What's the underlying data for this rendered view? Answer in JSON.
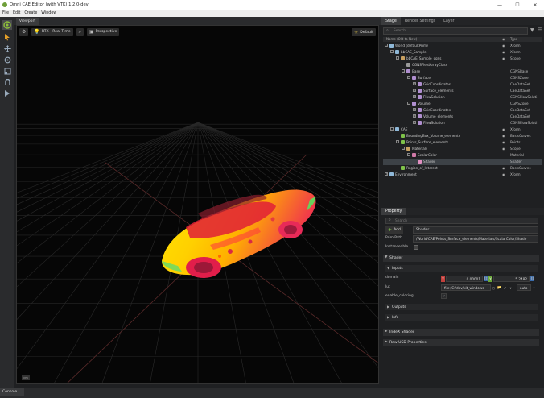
{
  "window": {
    "title": "Omni CAE Editor (with VTK) 1.2.0-dev",
    "minimize": "—",
    "maximize": "☐",
    "close": "✕"
  },
  "menu": [
    "File",
    "Edit",
    "Create",
    "Window"
  ],
  "viewport": {
    "tab": "Viewport",
    "renderer": "RTX - Real-Time",
    "camera": "Perspective",
    "default_label": "Default",
    "corner_label": "cm"
  },
  "console": {
    "tab": "Console"
  },
  "stage": {
    "tabs": [
      "Stage",
      "Render Settings",
      "Layer"
    ],
    "search_placeholder": "Search",
    "header_name": "Name (Old to New)",
    "header_type": "Type",
    "rows": [
      {
        "label": "World (defaultPrim)",
        "type": "Xform",
        "indent": 0,
        "exp": "-",
        "icon": "xform",
        "eye": true
      },
      {
        "label": "bbCAE_Sample",
        "type": "Xform",
        "indent": 1,
        "exp": "-",
        "icon": "xform",
        "eye": true
      },
      {
        "label": "bbCAE_Sample_cgns",
        "type": "Scope",
        "indent": 2,
        "exp": "-",
        "icon": "folder",
        "eye": true
      },
      {
        "label": "CGNSFieldArrayClass",
        "type": "",
        "indent": 3,
        "exp": "",
        "icon": "class",
        "eye": false
      },
      {
        "label": "Base",
        "type": "CGNSBase",
        "indent": 3,
        "exp": "-",
        "icon": "prim",
        "eye": false
      },
      {
        "label": "Surface",
        "type": "CGNSZone",
        "indent": 4,
        "exp": "-",
        "icon": "prim",
        "eye": false
      },
      {
        "label": "GridCoordinates",
        "type": "CaeDataSet",
        "indent": 5,
        "exp": "+",
        "icon": "prim",
        "eye": false
      },
      {
        "label": "Surface_elements",
        "type": "CaeDataSet",
        "indent": 5,
        "exp": "+",
        "icon": "prim",
        "eye": false
      },
      {
        "label": "FlowSolution",
        "type": "CGNSFlowSoluti",
        "indent": 5,
        "exp": "+",
        "icon": "prim",
        "eye": false
      },
      {
        "label": "Volume",
        "type": "CGNSZone",
        "indent": 4,
        "exp": "-",
        "icon": "prim",
        "eye": false
      },
      {
        "label": "GridCoordinates",
        "type": "CaeDataSet",
        "indent": 5,
        "exp": "+",
        "icon": "prim",
        "eye": false
      },
      {
        "label": "Volume_elements",
        "type": "CaeDataSet",
        "indent": 5,
        "exp": "+",
        "icon": "prim",
        "eye": false
      },
      {
        "label": "FlowSolution",
        "type": "CGNSFlowSoluti",
        "indent": 5,
        "exp": "+",
        "icon": "prim",
        "eye": false
      },
      {
        "label": "CAE",
        "type": "Xform",
        "indent": 1,
        "exp": "-",
        "icon": "xform",
        "eye": true
      },
      {
        "label": "BoundingBox_Volume_elements",
        "type": "BasisCurves",
        "indent": 2,
        "exp": "",
        "icon": "curve",
        "eye": true
      },
      {
        "label": "Points_Surface_elements",
        "type": "Points",
        "indent": 2,
        "exp": "-",
        "icon": "points",
        "eye": true
      },
      {
        "label": "Materials",
        "type": "Scope",
        "indent": 3,
        "exp": "-",
        "icon": "folder",
        "eye": true
      },
      {
        "label": "ScalarColor",
        "type": "Material",
        "indent": 4,
        "exp": "-",
        "icon": "material",
        "eye": false
      },
      {
        "label": "Shader",
        "type": "Shader",
        "indent": 5,
        "exp": "",
        "icon": "shader",
        "eye": false,
        "selected": true
      },
      {
        "label": "Region_of_Interest",
        "type": "BasisCurves",
        "indent": 2,
        "exp": "",
        "icon": "curve",
        "eye": true
      },
      {
        "label": "Environment",
        "type": "Xform",
        "indent": 0,
        "exp": "+",
        "icon": "xform",
        "eye": true
      }
    ]
  },
  "property": {
    "tab": "Property",
    "search_placeholder": "Search",
    "add_label": "Add",
    "prim_name": "Shader",
    "prim_path_label": "Prim Path",
    "prim_path": "/World/CAE/Points_Surface_elements/Materials/ScalarColor/Shade",
    "instanceable_label": "Instanceable",
    "shader_section": "Shader",
    "inputs_section": "Inputs",
    "domain_label": "domain",
    "domain_x_tag": "X",
    "domain_y_tag": "Y",
    "domain_min": "0.00001",
    "domain_max": "5.2482",
    "lut_label": "lut",
    "lut_path": "file:/C:/dev/kit_windows",
    "lut_mode": "auto",
    "enable_coloring_label": "enable_coloring",
    "outputs_section": "Outputs",
    "info_section": "Info",
    "indexx_section": "IndeX Shader",
    "raw_usd_section": "Raw USD Properties"
  }
}
